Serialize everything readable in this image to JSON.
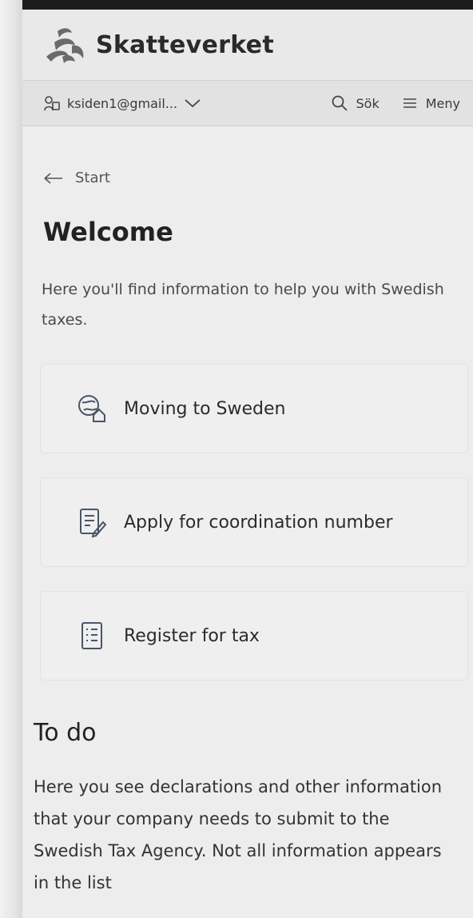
{
  "header": {
    "brand": "Skatteverket",
    "logo_icon": "skatteverket-logo"
  },
  "toolbar": {
    "account_label": "ksiden1@gmail...",
    "account_icon": "user-key-icon",
    "search_label": "Sök",
    "menu_label": "Meny"
  },
  "breadcrumb": {
    "label": "Start"
  },
  "page": {
    "title": "Welcome",
    "intro": "Here you'll find information to help you with Swedish taxes."
  },
  "cards": [
    {
      "label": "Moving to Sweden",
      "icon": "globe-house-icon"
    },
    {
      "label": "Apply for coordination number",
      "icon": "document-pen-icon"
    },
    {
      "label": "Register for tax",
      "icon": "form-list-icon"
    }
  ],
  "todo": {
    "title": "To do",
    "description": "Here you see declarations and other information that your company needs to submit to the Swedish Tax Agency. Not all information appears in the list"
  },
  "colors": {
    "background": "#ededed",
    "text": "#2b2b2b",
    "card_bg": "#efefef"
  }
}
